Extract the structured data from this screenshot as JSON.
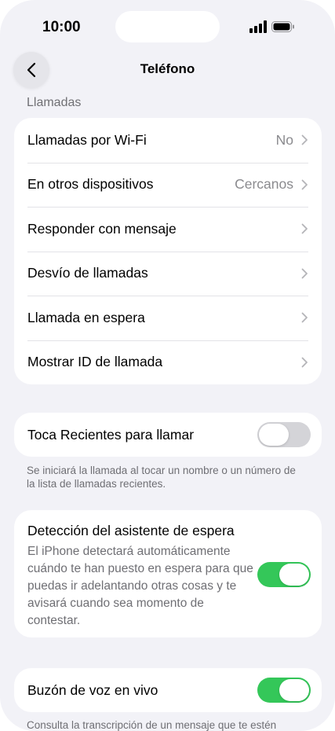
{
  "status_bar": {
    "time": "10:00"
  },
  "nav": {
    "title": "Teléfono"
  },
  "calls_section": {
    "header": "Llamadas",
    "rows": [
      {
        "label": "Llamadas por Wi-Fi",
        "value": "No"
      },
      {
        "label": "En otros dispositivos",
        "value": "Cercanos"
      },
      {
        "label": "Responder con mensaje",
        "value": ""
      },
      {
        "label": "Desvío de llamadas",
        "value": ""
      },
      {
        "label": "Llamada en espera",
        "value": ""
      },
      {
        "label": "Mostrar ID de llamada",
        "value": ""
      }
    ]
  },
  "tap_recents": {
    "label": "Toca Recientes para llamar",
    "enabled": false,
    "footer": "Se iniciará la llamada al tocar un nombre o un número de la lista de llamadas recientes."
  },
  "hold_assist": {
    "title": "Detección del asistente de espera",
    "description": "El iPhone detectará automáticamente cuándo te han puesto en espera para que puedas ir adelantando otras cosas y te avisará cuando sea momento de contestar.",
    "enabled": true
  },
  "live_voicemail": {
    "label": "Buzón de voz en vivo",
    "enabled": true,
    "footer": "Consulta la transcripción de un mensaje que te estén"
  },
  "colors": {
    "toggle_on": "#34c759",
    "toggle_off": "#d4d4d8",
    "background": "#f2f2f7"
  },
  "icons": [
    "back-chevron-icon",
    "signal-icon",
    "battery-icon",
    "chevron-right-icon"
  ]
}
